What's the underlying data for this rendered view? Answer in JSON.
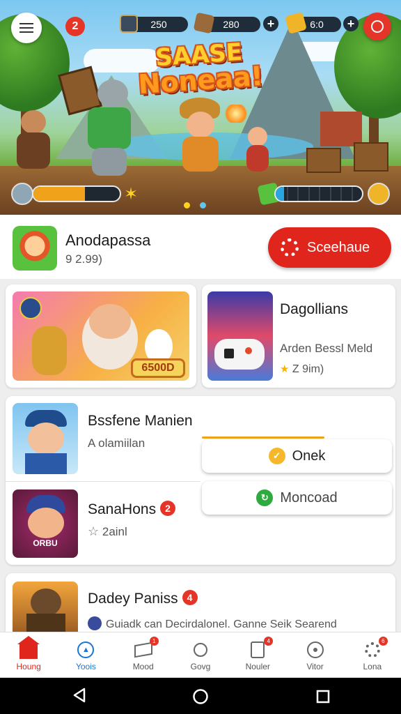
{
  "header": {
    "notification_count": "2",
    "resources": [
      {
        "name": "avatar-resource",
        "value": "250"
      },
      {
        "name": "wood-resource",
        "value": "280"
      },
      {
        "name": "gold-resource",
        "value": "6:0"
      }
    ],
    "plus_label": "+"
  },
  "hero": {
    "title_line1": "SAASE",
    "title_line2": "Noneaa!",
    "player_health_fraction": 0.6,
    "enemy_health_fraction": 0.1,
    "carousel_active_index": 0,
    "carousel_count": 2
  },
  "promo": {
    "title": "Anodapassa",
    "subtitle": "9 2.99)",
    "button_label": "Sceehaue"
  },
  "featured": {
    "card1": {
      "price_tag": "6500D"
    },
    "card2": {
      "title": "Dagollians",
      "subtitle": "Arden Bessl Meld",
      "rating": "Z 9im)"
    }
  },
  "list": [
    {
      "title": "Bssfene Manien",
      "subtitle": "A olamiilan",
      "thumb_label": ""
    },
    {
      "title": "SanaHons",
      "badge": "2",
      "subtitle": "2ainl",
      "thumb_label": "ORBU"
    },
    {
      "title": "Dadey Paniss",
      "badge": "4",
      "subtitle": "Guiadk can Decirdalonel. Ganne Seik Searend"
    }
  ],
  "actions": {
    "primary_label": "Onek",
    "secondary_label": "Moncoad"
  },
  "bottom_nav": [
    {
      "label": "Houng",
      "active": true,
      "badge": ""
    },
    {
      "label": "Yoois",
      "active": false,
      "badge": ""
    },
    {
      "label": "Mood",
      "active": false,
      "badge": "1"
    },
    {
      "label": "Govg",
      "active": false,
      "badge": ""
    },
    {
      "label": "Nouler",
      "active": false,
      "badge": "4"
    },
    {
      "label": "Vitor",
      "active": false,
      "badge": ""
    },
    {
      "label": "Lona",
      "active": false,
      "badge": "6"
    }
  ],
  "colors": {
    "accent_red": "#e0261c",
    "active_nav_blue": "#1976d2",
    "progress_orange": "#f0a21a",
    "enemy_bar_blue": "#2aa5e0"
  }
}
